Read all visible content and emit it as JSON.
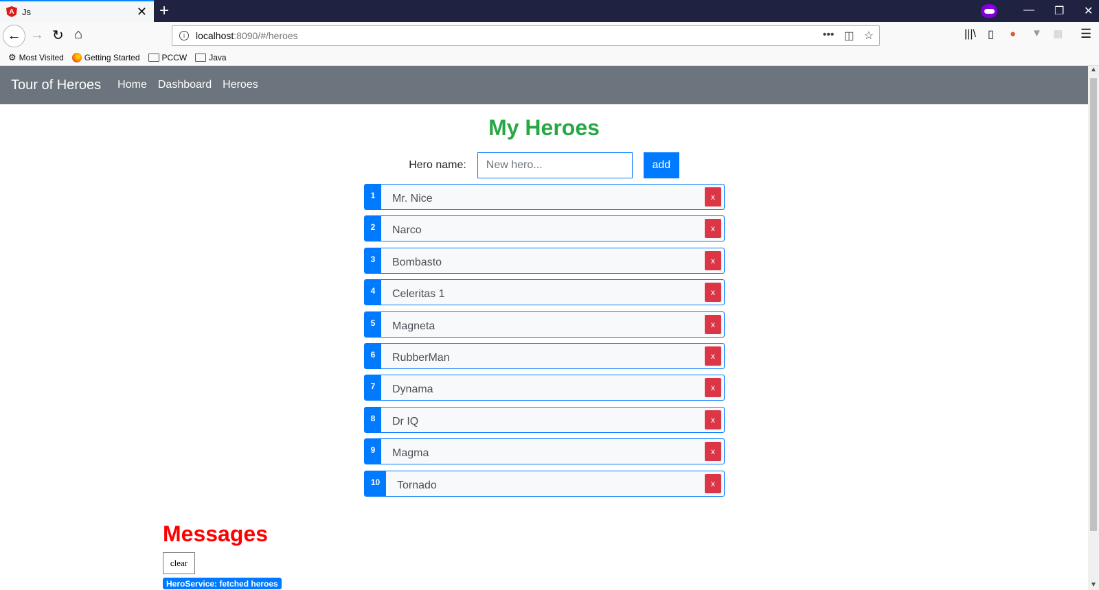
{
  "browser": {
    "tab_title": "Js",
    "favicon_letter": "A",
    "url_host": "localhost",
    "url_path": ":8090/#/heroes",
    "bookmarks": [
      "Most Visited",
      "Getting Started",
      "PCCW",
      "Java"
    ]
  },
  "app": {
    "brand": "Tour of Heroes",
    "nav": [
      "Home",
      "Dashboard",
      "Heroes"
    ],
    "title": "My Heroes",
    "hero_label": "Hero name:",
    "hero_placeholder": "New hero...",
    "add_label": "add",
    "delete_label": "x",
    "heroes": [
      {
        "id": "1",
        "name": "Mr. Nice"
      },
      {
        "id": "2",
        "name": "Narco"
      },
      {
        "id": "3",
        "name": "Bombasto"
      },
      {
        "id": "4",
        "name": "Celeritas 1"
      },
      {
        "id": "5",
        "name": "Magneta"
      },
      {
        "id": "6",
        "name": "RubberMan"
      },
      {
        "id": "7",
        "name": "Dynama"
      },
      {
        "id": "8",
        "name": "Dr IQ"
      },
      {
        "id": "9",
        "name": "Magma"
      },
      {
        "id": "10",
        "name": "Tornado"
      }
    ]
  },
  "messages": {
    "title": "Messages",
    "clear_label": "clear",
    "items": [
      "HeroService: fetched heroes"
    ]
  },
  "colors": {
    "primary": "#007bff",
    "danger": "#dc3545",
    "success": "#28a745",
    "navbar": "#6c757d",
    "messages_title": "#ff0000"
  }
}
